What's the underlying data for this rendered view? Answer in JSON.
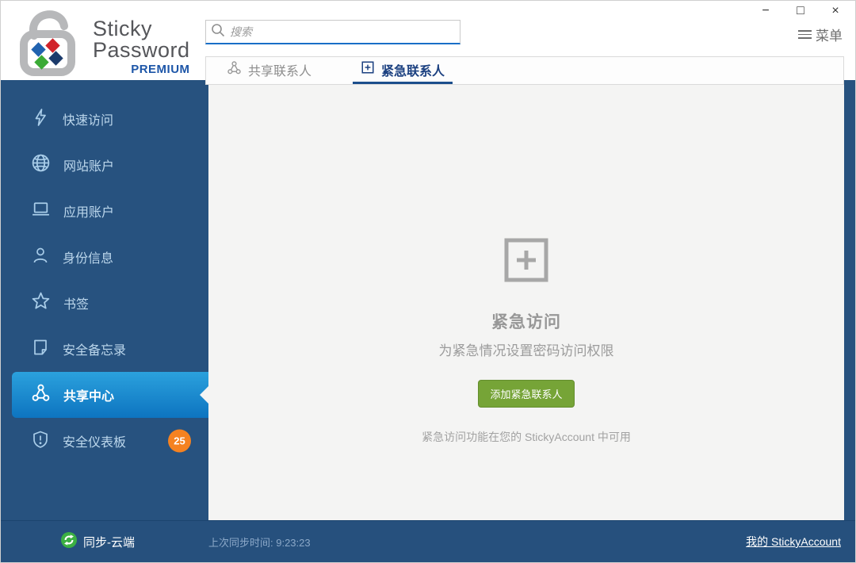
{
  "window_controls": {
    "minimize": "−",
    "maximize": "□",
    "close": "×"
  },
  "header": {
    "logo": {
      "line1": "Sticky",
      "line2": "Password",
      "badge": "PREMIUM"
    },
    "search": {
      "placeholder": "搜索"
    },
    "menu_label": "菜单"
  },
  "tabs": [
    {
      "label": "共享联系人",
      "active": false
    },
    {
      "label": "紧急联系人",
      "active": true
    }
  ],
  "sidebar": {
    "items": [
      {
        "label": "快速访问",
        "icon": "lightning-icon"
      },
      {
        "label": "网站账户",
        "icon": "globe-icon"
      },
      {
        "label": "应用账户",
        "icon": "laptop-icon"
      },
      {
        "label": "身份信息",
        "icon": "person-icon"
      },
      {
        "label": "书签",
        "icon": "star-icon"
      },
      {
        "label": "安全备忘录",
        "icon": "memo-icon"
      },
      {
        "label": "共享中心",
        "icon": "share-icon",
        "selected": true
      },
      {
        "label": "安全仪表板",
        "icon": "shield-icon",
        "badge": "25"
      }
    ]
  },
  "content": {
    "title": "紧急访问",
    "subtitle": "为紧急情况设置密码访问权限",
    "button_label": "添加紧急联系人",
    "note": "紧急访问功能在您的 StickyAccount 中可用"
  },
  "statusbar": {
    "sync_label": "同步-云端",
    "last_sync": "上次同步时间: 9:23:23",
    "account_link": "我的 StickyAccount"
  },
  "colors": {
    "sidebar_blue": "#27527f",
    "selected_gradient_top": "#2ba1dd",
    "selected_gradient_bottom": "#0d74c0",
    "accent_blue": "#1a6fc7",
    "active_tab_blue": "#1b4080",
    "button_green": "#76a437",
    "badge_orange": "#f58220",
    "sync_green": "#3cb043",
    "premium_blue": "#1d56a8",
    "content_bg": "#f4f4f3"
  }
}
